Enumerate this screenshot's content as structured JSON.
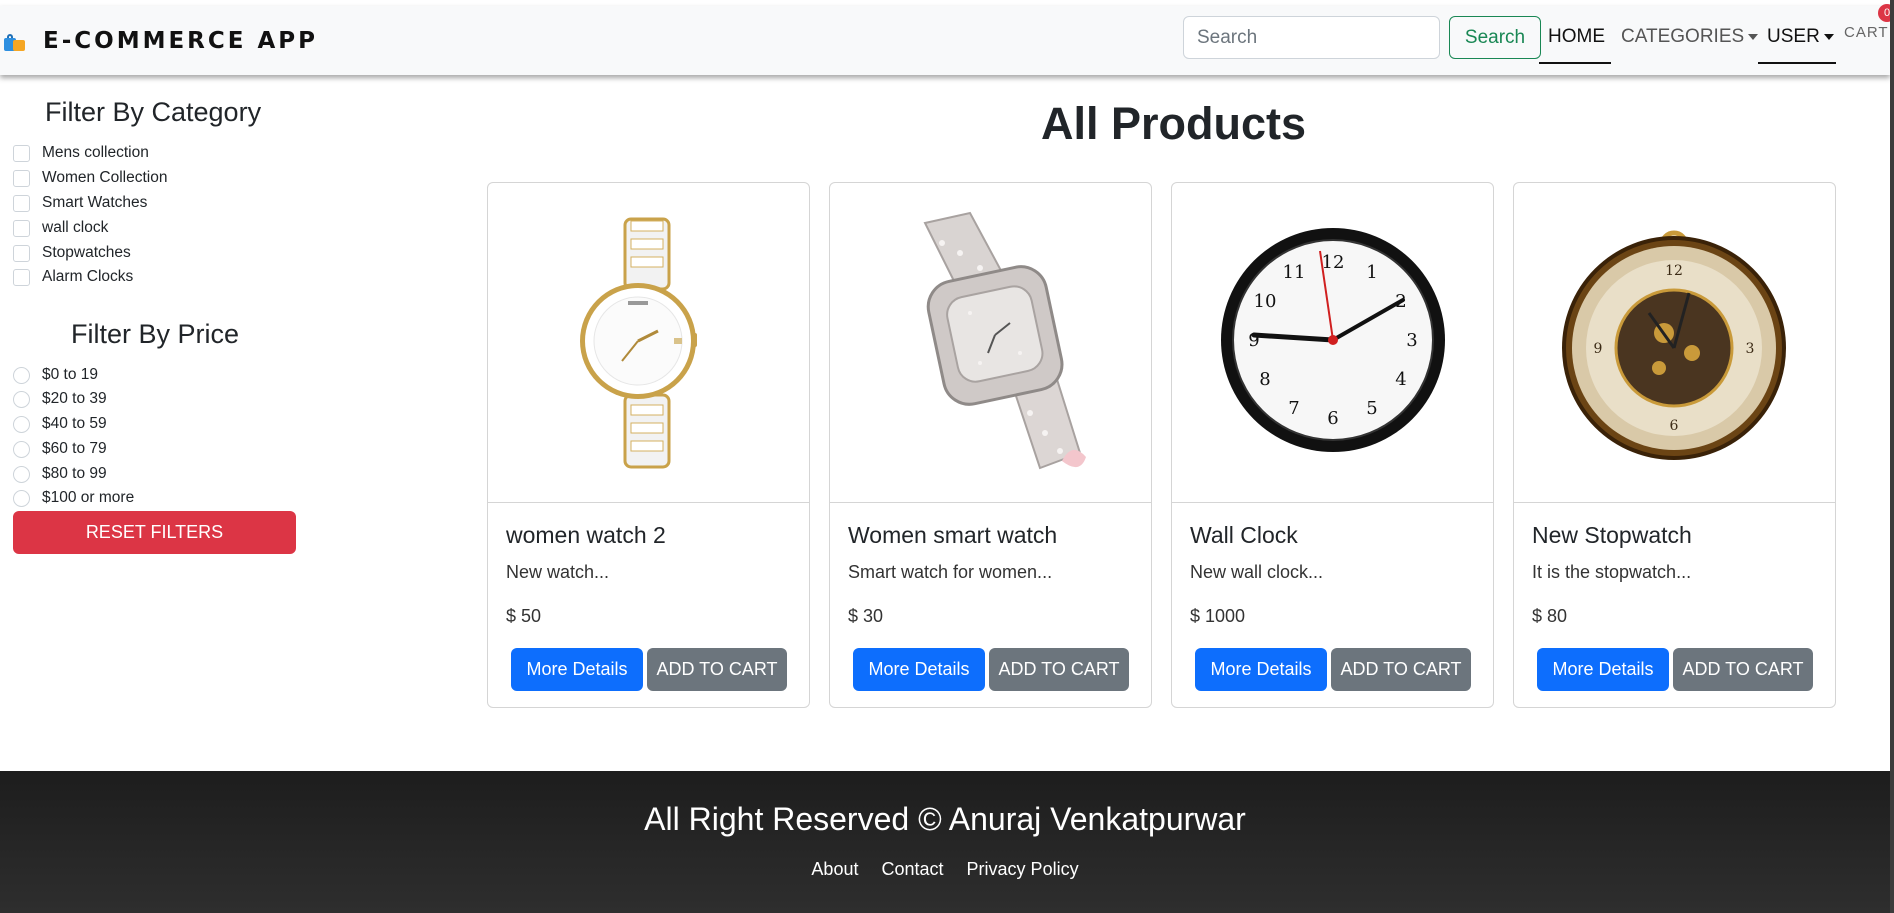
{
  "navbar": {
    "brand": "E-COMMERCE APP",
    "search_placeholder": "Search",
    "search_button": "Search",
    "home": "HOME",
    "categories": "CATEGORIES",
    "user": "USER",
    "cart": "CART",
    "cart_count": "0"
  },
  "sidebar": {
    "category_title": "Filter By Category",
    "categories": [
      "Mens collection",
      "Women Collection",
      "Smart Watches",
      "wall clock",
      "Stopwatches",
      "Alarm Clocks"
    ],
    "price_title": "Filter By Price",
    "prices": [
      "$0 to 19",
      "$20 to 39",
      "$40 to 59",
      "$60 to 79",
      "$80 to 99",
      "$100 or more"
    ],
    "reset_button": "RESET FILTERS"
  },
  "main": {
    "title": "All Products",
    "products": [
      {
        "name": "women watch 2",
        "description": "New watch...",
        "price": "$ 50",
        "details_button": "More Details",
        "cart_button": "ADD TO CART"
      },
      {
        "name": "Women smart watch",
        "description": "Smart watch for women...",
        "price": "$ 30",
        "details_button": "More Details",
        "cart_button": "ADD TO CART"
      },
      {
        "name": "Wall Clock",
        "description": "New wall clock...",
        "price": "$ 1000",
        "details_button": "More Details",
        "cart_button": "ADD TO CART"
      },
      {
        "name": "New Stopwatch",
        "description": "It is the stopwatch...",
        "price": "$ 80",
        "details_button": "More Details",
        "cart_button": "ADD TO CART"
      }
    ]
  },
  "footer": {
    "title": "All Right Reserved © Anuraj Venkatpurwar",
    "links": [
      "About",
      "Contact",
      "Privacy Policy"
    ]
  },
  "colors": {
    "primary": "#0d6efd",
    "secondary": "#6c757d",
    "danger": "#dc3545",
    "success": "#198754",
    "footer_bg": "#1d1d1d"
  }
}
